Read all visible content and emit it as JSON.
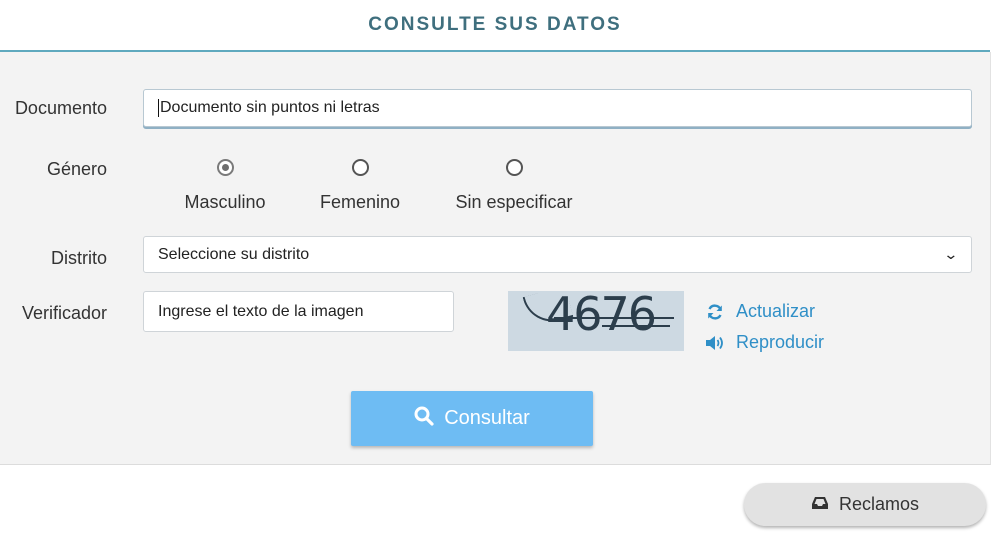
{
  "header": {
    "title": "CONSULTE SUS DATOS"
  },
  "form": {
    "documento": {
      "label": "Documento",
      "value": "Documento sin puntos ni letras"
    },
    "genero": {
      "label": "Género",
      "options": [
        "Masculino",
        "Femenino",
        "Sin especificar"
      ],
      "selected": "Masculino"
    },
    "distrito": {
      "label": "Distrito",
      "selected": "Seleccione su distrito"
    },
    "verificador": {
      "label": "Verificador",
      "value": "Ingrese el texto de la imagen",
      "captcha_text": "4676",
      "refresh_label": "Actualizar",
      "play_label": "Reproducir"
    },
    "submit_label": "Consultar"
  },
  "footer": {
    "reclamos_label": "Reclamos"
  },
  "colors": {
    "accent": "#6ebcf3",
    "link": "#2f8fc7",
    "header_text": "#3f6f7e",
    "header_border": "#5fa9be"
  },
  "icons": {
    "submit": "search-icon",
    "refresh": "refresh-icon",
    "play": "speaker-icon",
    "reclamos": "inbox-icon"
  }
}
